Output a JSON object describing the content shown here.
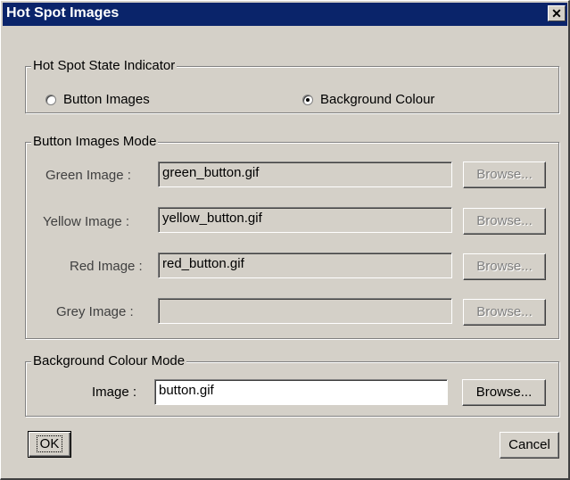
{
  "window": {
    "title": "Hot Spot Images",
    "close_glyph": "✕"
  },
  "state_indicator": {
    "legend": "Hot Spot State Indicator",
    "options": [
      {
        "label": "Button Images",
        "checked": false
      },
      {
        "label": "Background Colour",
        "checked": true
      }
    ]
  },
  "button_images_mode": {
    "legend": "Button Images Mode",
    "rows": [
      {
        "label": "Green Image :",
        "value": "green_button.gif",
        "browse": "Browse..."
      },
      {
        "label": "Yellow Image :",
        "value": "yellow_button.gif",
        "browse": "Browse..."
      },
      {
        "label": "Red Image :",
        "value": "red_button.gif",
        "browse": "Browse..."
      },
      {
        "label": "Grey Image :",
        "value": "",
        "browse": "Browse..."
      }
    ]
  },
  "background_colour_mode": {
    "legend": "Background Colour Mode",
    "label": "Image :",
    "value": "button.gif",
    "browse": "Browse..."
  },
  "footer": {
    "ok_label": "OK",
    "cancel_label": "Cancel"
  }
}
